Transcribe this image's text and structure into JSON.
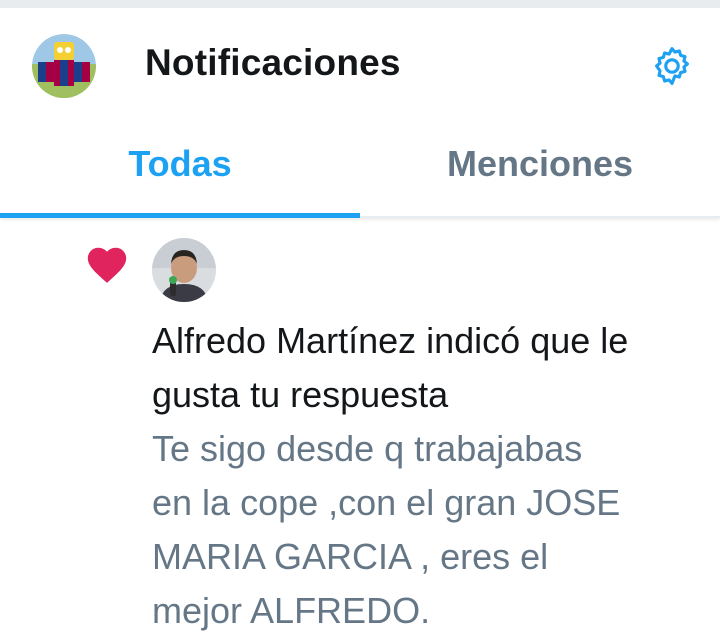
{
  "header": {
    "title": "Notificaciones"
  },
  "tabs": [
    {
      "label": "Todas",
      "active": true
    },
    {
      "label": "Menciones",
      "active": false
    }
  ],
  "notification": {
    "user_name": "Alfredo Martínez",
    "action_text": " indicó que le gusta tu respuesta",
    "snippet_lines": [
      "Te sigo desde q trabajabas",
      "en la cope ,con el gran JOSE",
      "MARIA GARCIA , eres el",
      "mejor ALFREDO."
    ]
  },
  "icons": {
    "settings": "gear-icon",
    "like": "heart-icon"
  },
  "colors": {
    "accent": "#1da1f2",
    "like": "#e0245e",
    "text_primary": "#14171a",
    "text_secondary": "#657786"
  }
}
